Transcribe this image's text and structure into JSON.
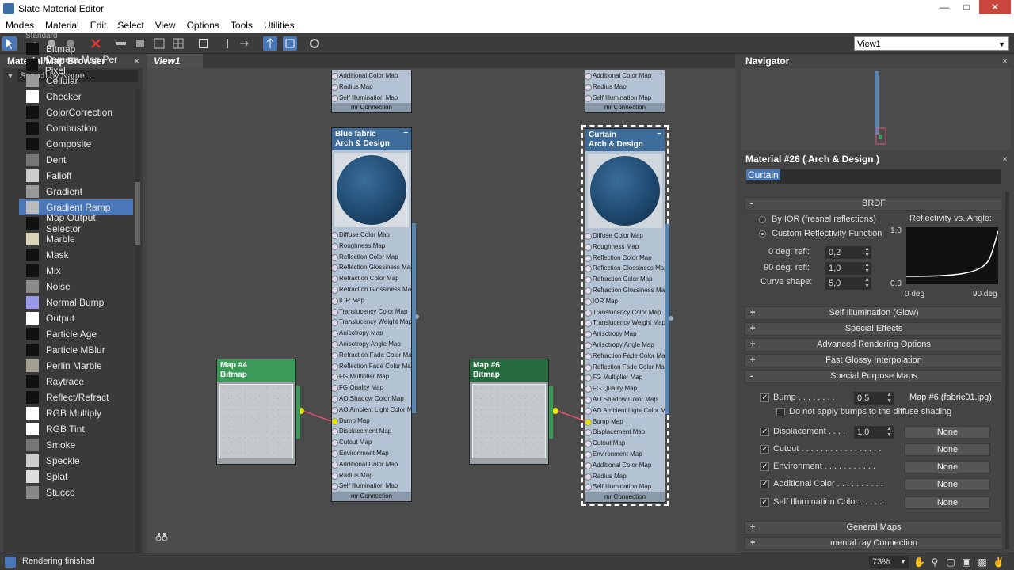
{
  "window": {
    "title": "Slate Material Editor"
  },
  "menu": [
    "Modes",
    "Material",
    "Edit",
    "Select",
    "View",
    "Options",
    "Tools",
    "Utilities"
  ],
  "view_selector": "View1",
  "browser": {
    "title": "Material/Map Browser",
    "search_placeholder": "Search by Name ...",
    "group_header": "Standard",
    "items": [
      {
        "label": "Bitmap",
        "swatch": "#111111"
      },
      {
        "label": "Camera Map Per Pixel",
        "swatch": "#111111"
      },
      {
        "label": "Cellular",
        "swatch": "#9a9a9a"
      },
      {
        "label": "Checker",
        "swatch": "#ffffff"
      },
      {
        "label": "ColorCorrection",
        "swatch": "#111111"
      },
      {
        "label": "Combustion",
        "swatch": "#111111"
      },
      {
        "label": "Composite",
        "swatch": "#111111"
      },
      {
        "label": "Dent",
        "swatch": "#777777"
      },
      {
        "label": "Falloff",
        "swatch": "#cccccc"
      },
      {
        "label": "Gradient",
        "swatch": "#999999"
      },
      {
        "label": "Gradient Ramp",
        "swatch": "#bbbbbb"
      },
      {
        "label": "Map Output Selector",
        "swatch": "#111111"
      },
      {
        "label": "Marble",
        "swatch": "#d8d4b8"
      },
      {
        "label": "Mask",
        "swatch": "#111111"
      },
      {
        "label": "Mix",
        "swatch": "#111111"
      },
      {
        "label": "Noise",
        "swatch": "#8a8a8a"
      },
      {
        "label": "Normal Bump",
        "swatch": "#9a98e8"
      },
      {
        "label": "Output",
        "swatch": "#ffffff"
      },
      {
        "label": "Particle Age",
        "swatch": "#111111"
      },
      {
        "label": "Particle MBlur",
        "swatch": "#111111"
      },
      {
        "label": "Perlin Marble",
        "swatch": "#a0a090"
      },
      {
        "label": "Raytrace",
        "swatch": "#111111"
      },
      {
        "label": "Reflect/Refract",
        "swatch": "#111111"
      },
      {
        "label": "RGB Multiply",
        "swatch": "#ffffff"
      },
      {
        "label": "RGB Tint",
        "swatch": "#ffffff"
      },
      {
        "label": "Smoke",
        "swatch": "#777777"
      },
      {
        "label": "Speckle",
        "swatch": "#cccccc"
      },
      {
        "label": "Splat",
        "swatch": "#dddddd"
      },
      {
        "label": "Stucco",
        "swatch": "#888888"
      }
    ],
    "selected": "Gradient Ramp"
  },
  "view_tab": "View1",
  "nodes": {
    "top_slots": [
      "Additional Color Map",
      "Radius Map",
      "Self Illumination Map"
    ],
    "mr_connection": "mr Connection",
    "blue_fabric": {
      "name": "Blue fabric",
      "type": "Arch & Design"
    },
    "curtain": {
      "name": "Curtain",
      "type": "Arch & Design"
    },
    "slots": [
      "Diffuse Color Map",
      "Roughness Map",
      "Reflection Color Map",
      "Reflection Glossiness Map",
      "Refraction Color Map",
      "Refraction Glossiness Map",
      "IOR Map",
      "Translucency Color Map",
      "Translucency Weight Map",
      "Anisotropy Map",
      "Anisotropy Angle Map",
      "Refraction Fade Color Map",
      "Reflection Fade Color Map",
      "FG Multiplier Map",
      "FG Quality Map",
      "AO Shadow Color Map",
      "AO Ambient Light Color Map",
      "Bump Map",
      "Displacement Map",
      "Cutout Map",
      "Environment Map",
      "Additional Color Map",
      "Radius Map",
      "Self Illumination Map"
    ],
    "map4": {
      "name": "Map #4",
      "type": "Bitmap"
    },
    "map6": {
      "name": "Map #6",
      "type": "Bitmap"
    }
  },
  "navigator": {
    "title": "Navigator"
  },
  "props": {
    "title": "Material #26  ( Arch & Design )",
    "name_value": "Curtain",
    "brdf": {
      "header": "BRDF",
      "by_ior": "By IOR (fresnel reflections)",
      "custom": "Custom Reflectivity Function",
      "deg0_label": "0 deg. refl:",
      "deg0_value": "0,2",
      "deg90_label": "90 deg. refl:",
      "deg90_value": "1,0",
      "curve_label": "Curve shape:",
      "curve_value": "5,0",
      "graph_title": "Reflectivity vs. Angle:",
      "y_max": "1.0",
      "y_min": "0.0",
      "x_min": "0 deg",
      "x_max": "90 deg"
    },
    "rollouts": [
      "Self Illumination (Glow)",
      "Special Effects",
      "Advanced Rendering Options",
      "Fast Glossy Interpolation",
      "Special Purpose Maps"
    ],
    "spm": {
      "bump_label": "Bump . . . . . . . .",
      "bump_value": "0,5",
      "bump_map": "Map #6 (fabric01.jpg)",
      "no_diffuse": "Do not apply bumps to the diffuse shading",
      "disp_label": "Displacement . . . .",
      "disp_value": "1,0",
      "disp_map": "None",
      "cutout_label": "Cutout . . . . . . . . . . . . . . . . .",
      "cutout_map": "None",
      "env_label": "Environment . . . . . . . . . . .",
      "env_map": "None",
      "addcol_label": "Additional Color . . . . . . . . . .",
      "addcol_map": "None",
      "selfillum_label": "Self Illumination Color . . . . . .",
      "selfillum_map": "None"
    },
    "bottom_rollouts": [
      "General Maps",
      "mental ray Connection"
    ]
  },
  "status": {
    "text": "Rendering finished",
    "zoom": "73%"
  }
}
